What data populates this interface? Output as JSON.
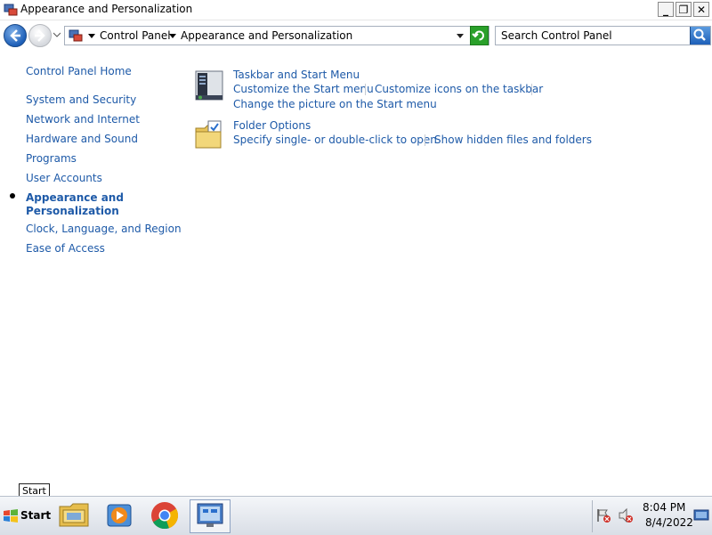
{
  "window": {
    "title": "Appearance and Personalization",
    "minimize_glyph": "_",
    "restore_glyph": "❐",
    "close_glyph": "✕"
  },
  "address_bar": {
    "crumbs": [
      "Control Panel",
      "Appearance and Personalization"
    ]
  },
  "search": {
    "placeholder": "Search Control Panel"
  },
  "sidebar": {
    "home": "Control Panel Home",
    "items": [
      {
        "label": "System and Security"
      },
      {
        "label": "Network and Internet"
      },
      {
        "label": "Hardware and Sound"
      },
      {
        "label": "Programs"
      },
      {
        "label": "User Accounts"
      },
      {
        "label": "Appearance and"
      },
      {
        "label": "Personalization"
      },
      {
        "label": "Clock, Language, and Region"
      },
      {
        "label": "Ease of Access"
      }
    ]
  },
  "sections": [
    {
      "heading": "Taskbar and Start Menu",
      "icon": "taskbar-icon",
      "tasks": [
        "Customize the Start menu",
        "Customize icons on the taskbar",
        "Change the picture on the Start menu"
      ]
    },
    {
      "heading": "Folder Options",
      "icon": "folder-options-icon",
      "tasks": [
        "Specify single- or double-click to open",
        "Show hidden files and folders"
      ]
    }
  ],
  "taskbar": {
    "start_label": "Start",
    "tooltip": "Start",
    "pinned": [
      "explorer-icon",
      "media-player-icon",
      "chrome-icon",
      "control-panel-icon"
    ],
    "time": "8:04 PM",
    "date": "8/4/2022"
  },
  "colors": {
    "link": "#1e5aa8",
    "taskbar": "#dfe4ea"
  }
}
